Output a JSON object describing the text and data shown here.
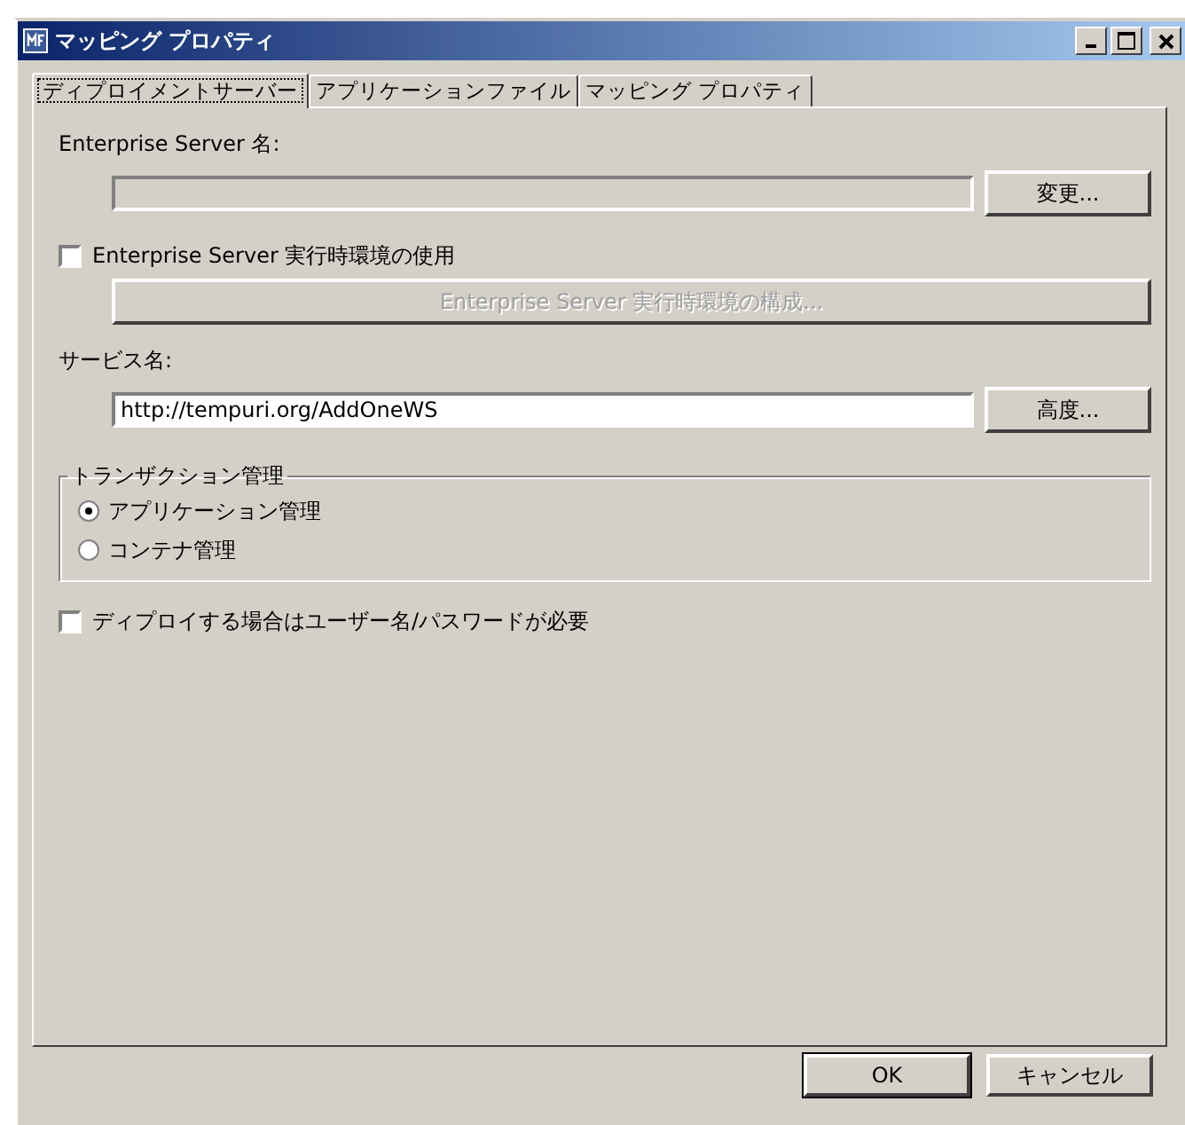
{
  "window": {
    "title": "マッピング プロパティ"
  },
  "tabs": [
    {
      "label": "ディプロイメントサーバー",
      "selected": true
    },
    {
      "label": "アプリケーションファイル",
      "selected": false
    },
    {
      "label": "マッピング プロパティ",
      "selected": false
    }
  ],
  "server_name": {
    "label": "Enterprise Server 名:",
    "disabled": true,
    "button": "変更..."
  },
  "use_runtime": {
    "label": "Enterprise Server 実行時環境の使用",
    "checked": false
  },
  "configure_button": {
    "label": "Enterprise Server 実行時環境の構成...",
    "disabled": true
  },
  "service_name": {
    "label": "サービス名:",
    "value": "http://tempuri.org/AddOneWS",
    "button": "高度..."
  },
  "transaction": {
    "title": "トランザクション管理",
    "options": [
      {
        "label": "アプリケーション管理",
        "selected": true
      },
      {
        "label": "コンテナ管理",
        "selected": false
      }
    ]
  },
  "require_credentials": {
    "label": "ディプロイする場合はユーザー名/パスワードが必要",
    "checked": false
  },
  "buttons": [
    "OK",
    "キャンセル"
  ]
}
